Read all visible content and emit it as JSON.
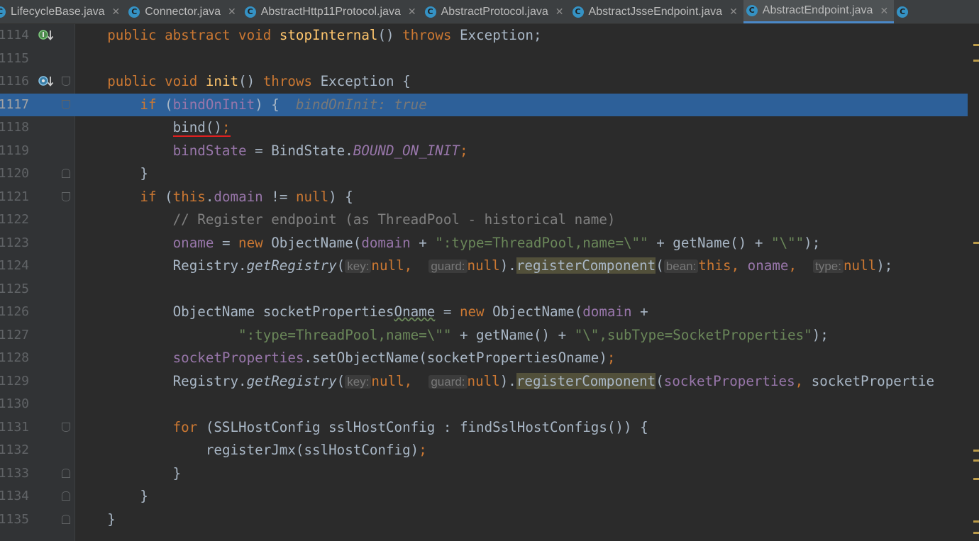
{
  "tabs": [
    {
      "label": "LifecycleBase.java",
      "active": false,
      "close": "✕"
    },
    {
      "label": "Connector.java",
      "active": false,
      "close": "✕"
    },
    {
      "label": "AbstractHttp11Protocol.java",
      "active": false,
      "close": "✕"
    },
    {
      "label": "AbstractProtocol.java",
      "active": false,
      "close": "✕"
    },
    {
      "label": "AbstractJsseEndpoint.java",
      "active": false,
      "close": "✕"
    },
    {
      "label": "AbstractEndpoint.java",
      "active": true,
      "close": "✕"
    }
  ],
  "tab_icon_letter": "C",
  "gutter_icons": {
    "implements": "implements-down-icon",
    "overrides": "overrides-down-icon"
  },
  "editor": {
    "line_numbers": [
      "1114",
      "1115",
      "1116",
      "1117",
      "1118",
      "1119",
      "1120",
      "1121",
      "1122",
      "1123",
      "1124",
      "1125",
      "1126",
      "1127",
      "1128",
      "1129",
      "1130",
      "1131",
      "1132",
      "1133",
      "1134",
      "1135"
    ],
    "selected_line": "1117",
    "l1114": {
      "kw": "public abstract void",
      "name": "stopInternal",
      "tail": "()",
      "throws": "throws",
      "exc": "Exception;"
    },
    "l1116": {
      "kw": "public void",
      "name": "init",
      "tail": "()",
      "throws": "throws",
      "exc": "Exception {"
    },
    "l1117": {
      "kw": "if",
      "open": "(",
      "var": "bindOnInit",
      "close": ") {",
      "inline": "bindOnInit: true"
    },
    "l1118": {
      "call": "bind()",
      "semi": ";"
    },
    "l1119": {
      "field": "bindState",
      "eq": " = BindState.",
      "const": "BOUND_ON_INIT",
      "semi": ";"
    },
    "l1120": {
      "text": "}"
    },
    "l1121": {
      "kw": "if",
      "open": " (",
      "this": "this",
      "dot": ".",
      "field": "domain",
      "ne": " != ",
      "nul": "null",
      "close": ") {"
    },
    "l1122": {
      "comment": "// Register endpoint (as ThreadPool - historical name)"
    },
    "l1123": {
      "field": "oname",
      "eq": " = ",
      "new": "new",
      "cls": " ObjectName(",
      "dom": "domain",
      "plus1": " + ",
      "str1": "\":type=ThreadPool,name=\\\"\"",
      "plus2": " + getName() + ",
      "str2": "\"\\\"\"",
      "end": ");"
    },
    "l1124": {
      "reg": "Registry.",
      "get": "getRegistry",
      "op": "(",
      "hkey": "key:",
      "null1": "null",
      "cm1": ", ",
      "hguard": "guard:",
      "null2": "null",
      "cl": ").",
      "regc": "registerComponent",
      "op2": "(",
      "hbean": "bean:",
      "thisv": "this",
      "cm2": ", ",
      "oname": "oname",
      "cm3": ", ",
      "htype": "type:",
      "null3": "null",
      "end": ");"
    },
    "l1126": {
      "cls": "ObjectName socketProperties",
      "wavy": "Oname",
      "eq": " = ",
      "new": "new",
      "call": " ObjectName(",
      "dom": "domain",
      "plus": " +"
    },
    "l1127": {
      "str1": "\":type=ThreadPool,name=\\\"\"",
      "mid": " + getName() + ",
      "str2": "\"\\\",subType=SocketProperties\"",
      "end": ");"
    },
    "l1128": {
      "field": "socketProperties",
      "rest": ".setObjectName(socketPropertiesOname)",
      "semi": ";"
    },
    "l1129": {
      "reg": "Registry.",
      "get": "getRegistry",
      "op": "(",
      "hkey": "key:",
      "null1": "null",
      "cm1": ", ",
      "hguard": "guard:",
      "null2": "null",
      "cl": ").",
      "regc": "registerComponent",
      "op2": "(",
      "sp": "socketProperties",
      "cm2": ", ",
      "tail": "socketPropertie"
    },
    "l1131": {
      "kw": "for",
      "rest": " (SSLHostConfig sslHostConfig : findSslHostConfigs()) {"
    },
    "l1132": {
      "call": "registerJmx(sslHostConfig)",
      "semi": ";"
    },
    "l1133": {
      "text": "}"
    },
    "l1134": {
      "text": "}"
    },
    "l1135": {
      "text": "}"
    }
  },
  "colors": {
    "keyword": "#cc7832",
    "method_decl": "#ffc66d",
    "field": "#9876aa",
    "string": "#6a8759",
    "comment": "#808080",
    "selection": "#2d6099",
    "background": "#2b2b2b"
  }
}
